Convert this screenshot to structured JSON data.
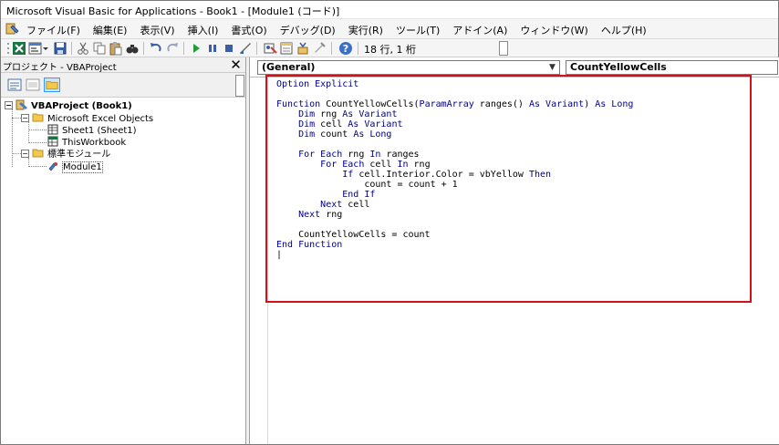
{
  "window": {
    "title": "Microsoft Visual Basic for Applications - Book1 - [Module1 (コード)]"
  },
  "menubar": {
    "items": [
      "ファイル(F)",
      "編集(E)",
      "表示(V)",
      "挿入(I)",
      "書式(O)",
      "デバッグ(D)",
      "実行(R)",
      "ツール(T)",
      "アドイン(A)",
      "ウィンドウ(W)",
      "ヘルプ(H)"
    ]
  },
  "toolbar": {
    "cursor_position": "18 行, 1 桁"
  },
  "project_pane": {
    "title": "プロジェクト - VBAProject",
    "close_label": "✕",
    "tree": {
      "project": "VBAProject (Book1)",
      "excel_objects_folder": "Microsoft Excel Objects",
      "sheet1": "Sheet1 (Sheet1)",
      "this_workbook": "ThisWorkbook",
      "modules_folder": "標準モジュール",
      "module1": "Module1"
    }
  },
  "code_pane": {
    "object_combo": "(General)",
    "procedure_combo": "CountYellowCells",
    "lines": [
      [
        {
          "t": "Option Explicit",
          "k": true
        }
      ],
      [
        {
          "t": ""
        }
      ],
      [
        {
          "t": "Function ",
          "k": true
        },
        {
          "t": "CountYellowCells("
        },
        {
          "t": "ParamArray",
          "k": true
        },
        {
          "t": " ranges() "
        },
        {
          "t": "As Variant",
          "k": true
        },
        {
          "t": ") "
        },
        {
          "t": "As Long",
          "k": true
        }
      ],
      [
        {
          "t": "    "
        },
        {
          "t": "Dim",
          "k": true
        },
        {
          "t": " rng "
        },
        {
          "t": "As Variant",
          "k": true
        }
      ],
      [
        {
          "t": "    "
        },
        {
          "t": "Dim",
          "k": true
        },
        {
          "t": " cell "
        },
        {
          "t": "As Variant",
          "k": true
        }
      ],
      [
        {
          "t": "    "
        },
        {
          "t": "Dim",
          "k": true
        },
        {
          "t": " count "
        },
        {
          "t": "As Long",
          "k": true
        }
      ],
      [
        {
          "t": ""
        }
      ],
      [
        {
          "t": "    "
        },
        {
          "t": "For Each",
          "k": true
        },
        {
          "t": " rng "
        },
        {
          "t": "In",
          "k": true
        },
        {
          "t": " ranges"
        }
      ],
      [
        {
          "t": "        "
        },
        {
          "t": "For Each",
          "k": true
        },
        {
          "t": " cell "
        },
        {
          "t": "In",
          "k": true
        },
        {
          "t": " rng"
        }
      ],
      [
        {
          "t": "            "
        },
        {
          "t": "If",
          "k": true
        },
        {
          "t": " cell.Interior.Color = vbYellow "
        },
        {
          "t": "Then",
          "k": true
        }
      ],
      [
        {
          "t": "                count = count + 1"
        }
      ],
      [
        {
          "t": "            "
        },
        {
          "t": "End If",
          "k": true
        }
      ],
      [
        {
          "t": "        "
        },
        {
          "t": "Next",
          "k": true
        },
        {
          "t": " cell"
        }
      ],
      [
        {
          "t": "    "
        },
        {
          "t": "Next",
          "k": true
        },
        {
          "t": " rng"
        }
      ],
      [
        {
          "t": ""
        }
      ],
      [
        {
          "t": "    CountYellowCells = count"
        }
      ],
      [
        {
          "t": "End Function",
          "k": true
        }
      ],
      [
        {
          "t": "|"
        }
      ]
    ]
  },
  "colors": {
    "keyword": "#00008b",
    "highlight_border": "#d0121b"
  }
}
